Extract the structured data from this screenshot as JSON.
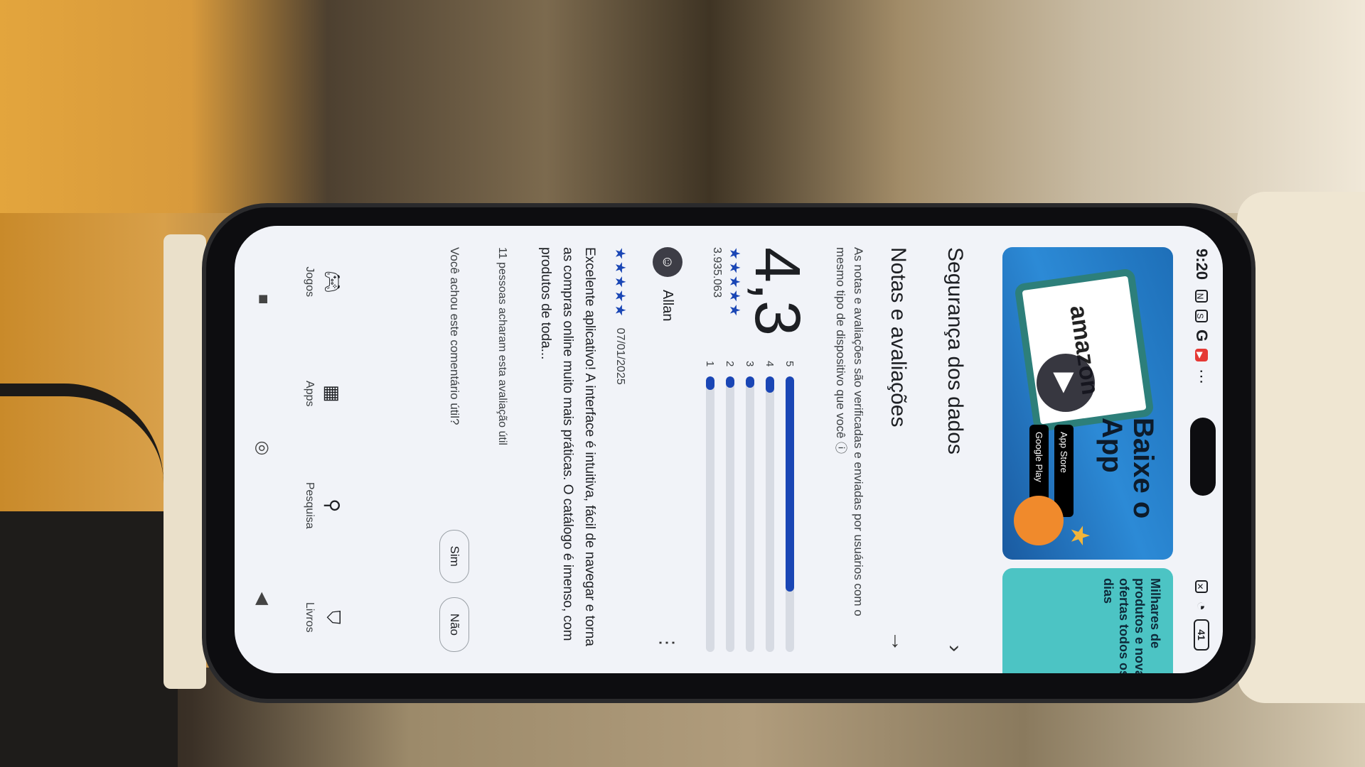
{
  "status": {
    "time": "9:20",
    "battery": "41"
  },
  "banner": {
    "brand": "amazon",
    "title": "Baixe o App",
    "badge_apple": "App Store",
    "badge_google": "Google Play",
    "side_text": "Milhares de produtos e novas ofertas todos os dias"
  },
  "sections": {
    "data_safety": "Segurança dos dados",
    "ratings": "Notas e avaliações",
    "ratings_desc": "As notas e avaliações são verificadas e enviadas por usuários com o mesmo tipo de dispositivo que você"
  },
  "rating": {
    "value": "4,3",
    "stars": "★★★★★",
    "count": "3.935.063",
    "distribution": [
      {
        "label": "5",
        "fraction": 0.78
      },
      {
        "label": "4",
        "fraction": 0.06
      },
      {
        "label": "3",
        "fraction": 0.04
      },
      {
        "label": "2",
        "fraction": 0.04
      },
      {
        "label": "1",
        "fraction": 0.05
      }
    ]
  },
  "review": {
    "author": "Allan",
    "stars": "★★★★★",
    "date": "07/01/2025",
    "text": "Excelente aplicativo! A interface é intuitiva, fácil de navegar e torna as compras online muito mais práticas. O catálogo é imenso, com produtos de toda...",
    "helpful_count": "11 pessoas acharam esta avaliação útil",
    "helpful_question": "Você achou este comentário útil?",
    "yes": "Sim",
    "no": "Não"
  },
  "nav": {
    "games": "Jogos",
    "apps": "Apps",
    "search": "Pesquisa",
    "books": "Livros"
  },
  "colors": {
    "accent": "#1a46b5",
    "screen_bg": "#f1f3f8"
  }
}
